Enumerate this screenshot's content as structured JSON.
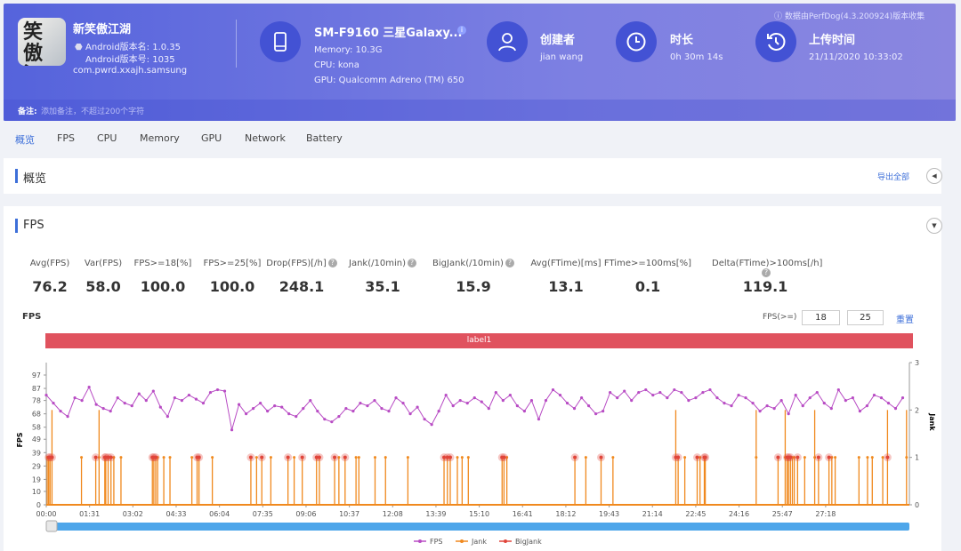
{
  "app": {
    "icon_text": "笑傲江湖",
    "name": "新笑傲江湖",
    "version_name": "Android版本名: 1.0.35",
    "version_code": "Android版本号: 1035",
    "package": "com.pwrd.xxajh.samsung"
  },
  "device": {
    "name": "SM-F9160 三星Galaxy...",
    "memory": "Memory: 10.3G",
    "cpu": "CPU: kona",
    "gpu": "GPU: Qualcomm Adreno (TM) 650"
  },
  "creator": {
    "label": "创建者",
    "value": "jian wang"
  },
  "duration": {
    "label": "时长",
    "value": "0h 30m 14s"
  },
  "upload": {
    "label": "上传时间",
    "value": "21/11/2020 10:33:02"
  },
  "perfdog_note": "ⓘ 数据由PerfDog(4.3.200924)版本收集",
  "note": {
    "label": "备注:",
    "placeholder": "添加备注，不超过200个字符"
  },
  "tabs": [
    "概览",
    "FPS",
    "CPU",
    "Memory",
    "GPU",
    "Network",
    "Battery"
  ],
  "overview": {
    "title": "概览",
    "export": "导出全部"
  },
  "fps_section": {
    "title": "FPS"
  },
  "metrics": [
    {
      "label": "Avg(FPS)",
      "value": "76.2"
    },
    {
      "label": "Var(FPS)",
      "value": "58.0"
    },
    {
      "label": "FPS>=18[%]",
      "value": "100.0"
    },
    {
      "label": "FPS>=25[%]",
      "value": "100.0"
    },
    {
      "label": "Drop(FPS)[/h]",
      "value": "248.1",
      "help": true
    },
    {
      "label": "Jank(/10min)",
      "value": "35.1",
      "help": true
    },
    {
      "label": "BigJank(/10min)",
      "value": "15.9",
      "help": true
    },
    {
      "label": "Avg(FTime)[ms]",
      "value": "13.1"
    },
    {
      "label": "FTime>=100ms[%]",
      "value": "0.1"
    },
    {
      "label": "Delta(FTime)>100ms[/h]",
      "value": "119.1",
      "help": true
    }
  ],
  "chart_controls": {
    "title": "FPS",
    "threshold_label": "FPS(>=)",
    "threshold1": "18",
    "threshold2": "25",
    "reset": "重置",
    "label_bar": "label1"
  },
  "colors": {
    "header": "#5865e0",
    "fps": "#b84cc4",
    "jank": "#f0891e",
    "bigjank": "#e0443a",
    "label_bar": "#e0525e",
    "slider": "#4ea6ea"
  },
  "chart_data": {
    "type": "line",
    "ylabel": "FPS",
    "y2label": "Jank",
    "yticks": [
      0,
      10,
      19,
      29,
      39,
      49,
      58,
      68,
      78,
      87,
      97
    ],
    "y2ticks": [
      0,
      1,
      2,
      3
    ],
    "xticks": [
      "00:00",
      "01:31",
      "03:02",
      "04:33",
      "06:04",
      "07:35",
      "09:06",
      "10:37",
      "12:08",
      "13:39",
      "15:10",
      "16:41",
      "18:12",
      "19:43",
      "21:14",
      "22:45",
      "24:16",
      "25:47",
      "27:18"
    ],
    "xlim_seconds": [
      0,
      1814
    ],
    "legend": [
      "FPS",
      "Jank",
      "BigJank"
    ],
    "legend_position": "bottom",
    "fps_interval_seconds": 15,
    "fps": [
      82,
      76,
      70,
      66,
      80,
      78,
      88,
      75,
      72,
      70,
      80,
      76,
      74,
      83,
      78,
      85,
      73,
      66,
      80,
      78,
      82,
      79,
      76,
      84,
      86,
      85,
      56,
      75,
      68,
      72,
      76,
      70,
      74,
      73,
      68,
      66,
      72,
      78,
      70,
      64,
      62,
      66,
      72,
      70,
      76,
      74,
      78,
      72,
      70,
      80,
      76,
      68,
      73,
      64,
      60,
      70,
      82,
      74,
      78,
      76,
      80,
      77,
      72,
      84,
      78,
      82,
      74,
      70,
      78,
      64,
      78,
      86,
      82,
      76,
      72,
      80,
      74,
      68,
      70,
      84,
      80,
      85,
      78,
      84,
      86,
      82,
      84,
      80,
      86,
      84,
      78,
      80,
      84,
      86,
      80,
      76,
      74,
      82,
      80,
      76,
      70,
      74,
      72,
      78,
      68,
      82,
      74,
      80,
      84,
      76,
      72,
      86,
      78,
      80,
      70,
      74,
      82,
      80,
      76,
      72,
      80
    ],
    "jank_seconds": [
      [
        2,
        1
      ],
      [
        5,
        1
      ],
      [
        8,
        1
      ],
      [
        12,
        2
      ],
      [
        74,
        1
      ],
      [
        104,
        1
      ],
      [
        111,
        2
      ],
      [
        123,
        1
      ],
      [
        125,
        1
      ],
      [
        130,
        1
      ],
      [
        136,
        1
      ],
      [
        142,
        1
      ],
      [
        157,
        1
      ],
      [
        223,
        1
      ],
      [
        226,
        1
      ],
      [
        230,
        1
      ],
      [
        234,
        1
      ],
      [
        247,
        1
      ],
      [
        260,
        1
      ],
      [
        306,
        1
      ],
      [
        317,
        1
      ],
      [
        321,
        1
      ],
      [
        349,
        1
      ],
      [
        430,
        1
      ],
      [
        442,
        1
      ],
      [
        453,
        1
      ],
      [
        472,
        1
      ],
      [
        508,
        1
      ],
      [
        521,
        1
      ],
      [
        538,
        1
      ],
      [
        568,
        1
      ],
      [
        574,
        1
      ],
      [
        606,
        1
      ],
      [
        615,
        1
      ],
      [
        628,
        1
      ],
      [
        651,
        1
      ],
      [
        657,
        1
      ],
      [
        691,
        1
      ],
      [
        713,
        1
      ],
      [
        760,
        1
      ],
      [
        836,
        1
      ],
      [
        843,
        1
      ],
      [
        849,
        1
      ],
      [
        864,
        1
      ],
      [
        874,
        1
      ],
      [
        887,
        1
      ],
      [
        958,
        1
      ],
      [
        962,
        1
      ],
      [
        968,
        1
      ],
      [
        1111,
        1
      ],
      [
        1134,
        1
      ],
      [
        1166,
        1
      ],
      [
        1191,
        1
      ],
      [
        1323,
        2
      ],
      [
        1328,
        1
      ],
      [
        1342,
        1
      ],
      [
        1368,
        1
      ],
      [
        1374,
        1
      ],
      [
        1383,
        1
      ],
      [
        1385,
        1
      ],
      [
        1492,
        2
      ],
      [
        1538,
        1
      ],
      [
        1553,
        2
      ],
      [
        1557,
        1
      ],
      [
        1560,
        1
      ],
      [
        1564,
        1
      ],
      [
        1568,
        1
      ],
      [
        1572,
        1
      ],
      [
        1579,
        1
      ],
      [
        1594,
        1
      ],
      [
        1615,
        2
      ],
      [
        1623,
        1
      ],
      [
        1645,
        1
      ],
      [
        1651,
        1
      ],
      [
        1658,
        1
      ],
      [
        1708,
        1
      ],
      [
        1726,
        1
      ],
      [
        1736,
        1
      ],
      [
        1758,
        1
      ],
      [
        1768,
        2
      ],
      [
        1808,
        2
      ]
    ],
    "bigjank_seconds": [
      5,
      8,
      12,
      104,
      123,
      125,
      130,
      136,
      223,
      226,
      230,
      317,
      321,
      430,
      453,
      508,
      538,
      568,
      574,
      606,
      628,
      836,
      843,
      849,
      958,
      962,
      1111,
      1166,
      1323,
      1328,
      1368,
      1383,
      1385,
      1538,
      1557,
      1560,
      1564,
      1579,
      1623,
      1645,
      1768
    ]
  }
}
